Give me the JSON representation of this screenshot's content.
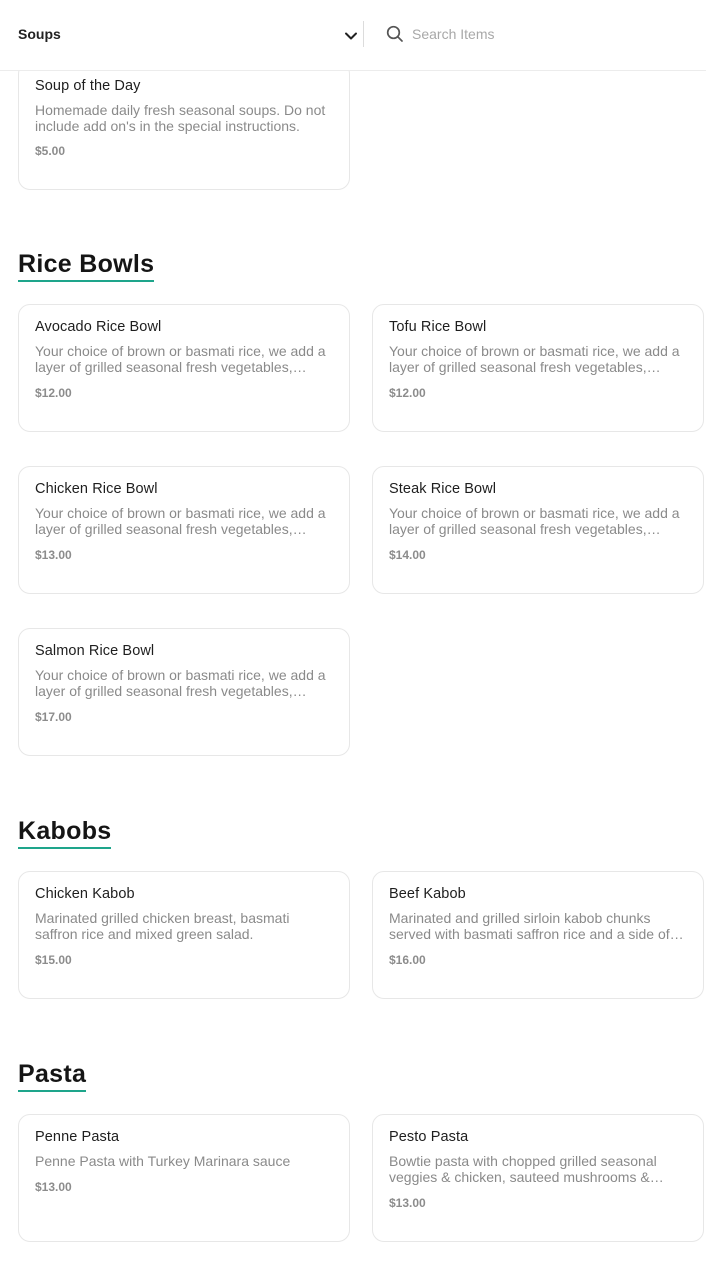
{
  "header": {
    "category_selected": "Soups",
    "search_placeholder": "Search Items"
  },
  "sections": [
    {
      "title": "",
      "items": [
        {
          "name": "Soup of the Day",
          "description": "Homemade daily fresh seasonal soups. Do not include add on's in the special instructions.",
          "price": "$5.00"
        }
      ]
    },
    {
      "title": "Rice Bowls",
      "items": [
        {
          "name": "Avocado Rice Bowl",
          "description": "Your choice of brown or basmati rice, we add a layer of grilled seasonal fresh vegetables, topped with your choice of protein.",
          "price": "$12.00"
        },
        {
          "name": "Tofu Rice Bowl",
          "description": "Your choice of brown or basmati rice, we add a layer of grilled seasonal fresh vegetables, topped with your choice of protein.",
          "price": "$12.00"
        },
        {
          "name": "Chicken Rice Bowl",
          "description": "Your choice of brown or basmati rice, we add a layer of grilled seasonal fresh vegetables, topped with your choice of protein.",
          "price": "$13.00"
        },
        {
          "name": "Steak Rice Bowl",
          "description": "Your choice of brown or basmati rice, we add a layer of grilled seasonal fresh vegetables, topped with your choice of protein.",
          "price": "$14.00"
        },
        {
          "name": "Salmon Rice Bowl",
          "description": "Your choice of brown or basmati rice, we add a layer of grilled seasonal fresh vegetables, topped with your choice of protein.",
          "price": "$17.00"
        }
      ]
    },
    {
      "title": "Kabobs",
      "items": [
        {
          "name": "Chicken Kabob",
          "description": "Marinated grilled chicken breast, basmati saffron rice and mixed green salad.",
          "price": "$15.00"
        },
        {
          "name": "Beef Kabob",
          "description": "Marinated and grilled sirloin kabob chunks served with basmati saffron rice and a side of mixed green salad.",
          "price": "$16.00"
        }
      ]
    },
    {
      "title": "Pasta",
      "items": [
        {
          "name": "Penne Pasta",
          "description": "Penne Pasta with Turkey Marinara sauce",
          "price": "$13.00"
        },
        {
          "name": "Pesto Pasta",
          "description": "Bowtie pasta with chopped grilled seasonal veggies & chicken, sauteed mushrooms & spinach.",
          "price": "$13.00"
        }
      ]
    }
  ],
  "colors": {
    "accent_underline": "#1ea58b",
    "card_border": "#e7e7e7",
    "muted_text": "#8a8a8a"
  },
  "icons": {
    "dropdown": "chevron-down-icon",
    "search": "search-icon"
  }
}
